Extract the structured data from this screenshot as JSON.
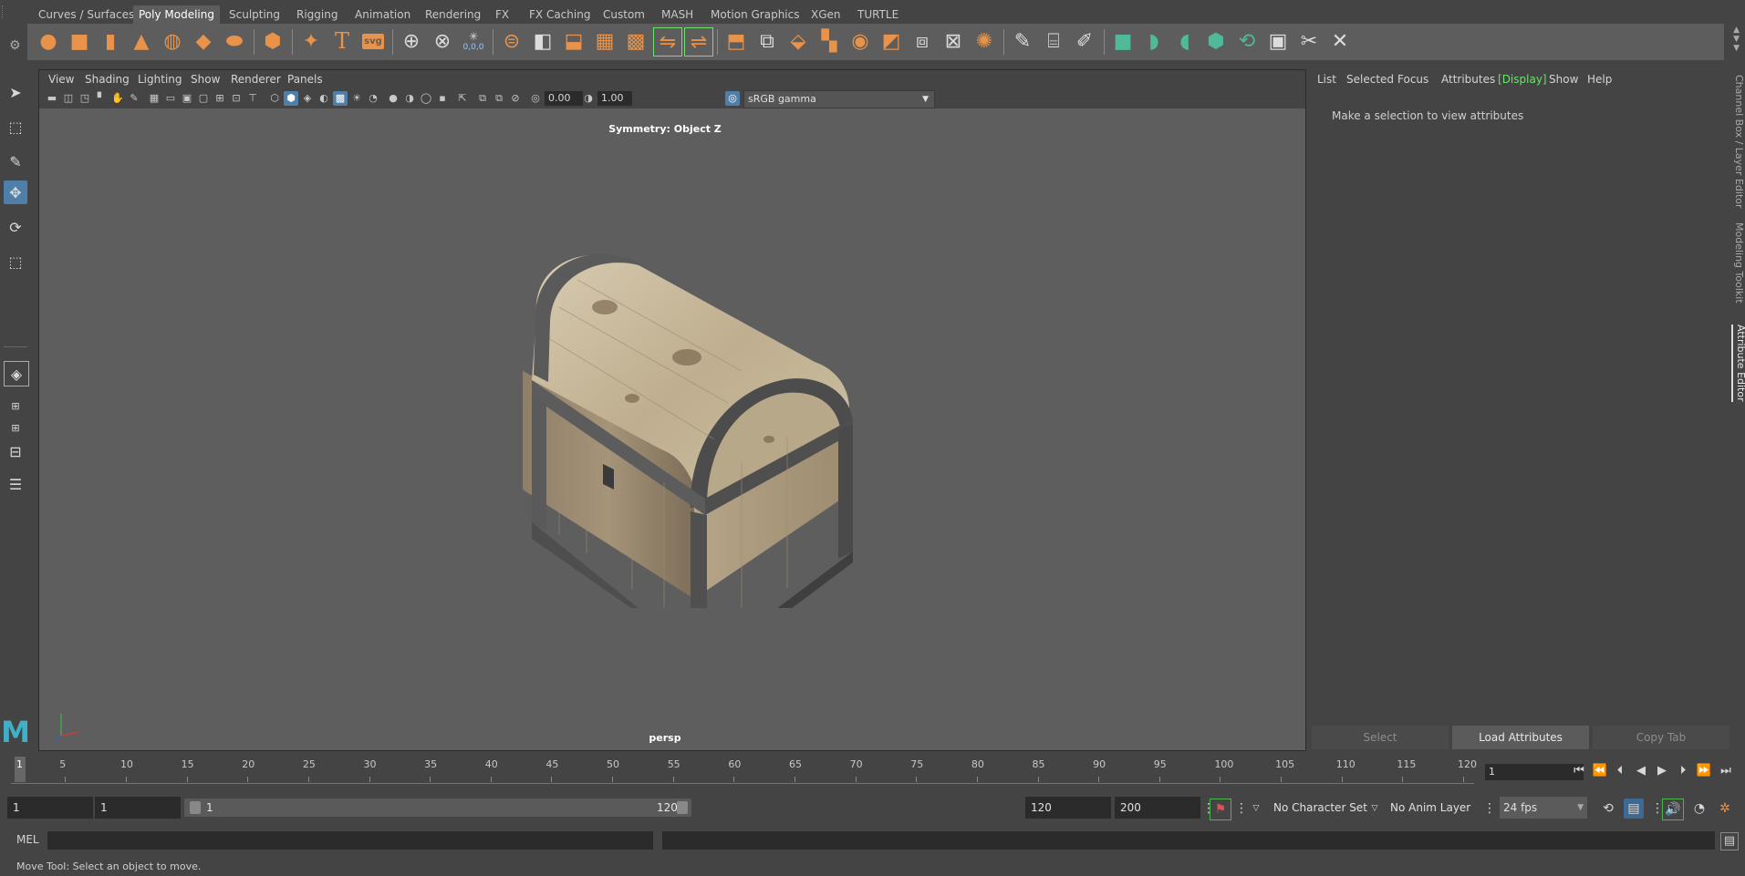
{
  "shelf": {
    "tabs": [
      "Curves / Surfaces",
      "Poly Modeling",
      "Sculpting",
      "Rigging",
      "Animation",
      "Rendering",
      "FX",
      "FX Caching",
      "Custom",
      "MASH",
      "Motion Graphics",
      "XGen",
      "TURTLE"
    ],
    "active_tab": "Poly Modeling",
    "svg_label": "svg",
    "text_tool_label": "T",
    "origin_label": "0,0,0"
  },
  "viewport": {
    "menu": [
      "View",
      "Shading",
      "Lighting",
      "Show",
      "Renderer",
      "Panels"
    ],
    "exposure_value": "0.00",
    "gamma_value": "1.00",
    "color_space": "sRGB gamma",
    "symmetry_label": "Symmetry: Object Z",
    "camera_label": "persp"
  },
  "attribute_editor": {
    "menu": [
      "List",
      "Selected",
      "Focus",
      "Attributes",
      "Display",
      "Show",
      "Help"
    ],
    "message": "Make a selection to view attributes",
    "buttons": [
      "Select",
      "Load Attributes",
      "Copy Tab"
    ]
  },
  "side_tabs": [
    "Channel Box / Layer Editor",
    "Modeling Toolkit",
    "Attribute Editor"
  ],
  "time_slider": {
    "ticks": [
      "5",
      "10",
      "15",
      "20",
      "25",
      "30",
      "35",
      "40",
      "45",
      "50",
      "55",
      "60",
      "65",
      "70",
      "75",
      "80",
      "85",
      "90",
      "95",
      "100",
      "105",
      "110",
      "115",
      "120"
    ],
    "start_label": "1",
    "current_frame": "1"
  },
  "range": {
    "start_time": "1",
    "playback_start": "1",
    "range_start_label": "1",
    "range_end_label": "120",
    "playback_end": "120",
    "end_time": "200",
    "character_set": "No Character Set",
    "anim_layer": "No Anim Layer",
    "fps": "24 fps"
  },
  "command_line": {
    "label": "MEL"
  },
  "help_line": "Move Tool: Select an object to move.",
  "colors": {
    "accent_blue": "#4f7fa8",
    "display_green": "#6ee16e",
    "shelf_orange": "#e8924a",
    "shelf_teal": "#4fb99a"
  }
}
